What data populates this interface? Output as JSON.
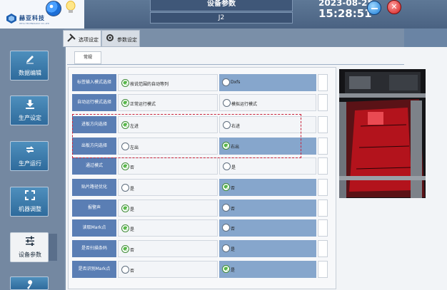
{
  "header": {
    "logo_text": "赫亚科技",
    "logo_sub": "HEYA TECHNOLOGY CO.,LTD",
    "title": "设备参数",
    "subtitle": "J2",
    "date": "2023-08-25",
    "time": "15:28:51"
  },
  "sidebar": {
    "items": [
      {
        "label": "数据编辑",
        "icon": "pencil-icon"
      },
      {
        "label": "生产设定",
        "icon": "download-icon"
      },
      {
        "label": "生产运行",
        "icon": "cycle-icon"
      },
      {
        "label": "机器调整",
        "icon": "frame-icon"
      },
      {
        "label": "设备参数",
        "icon": "sliders-icon",
        "active": true
      },
      {
        "label": "",
        "icon": "wrench-icon"
      }
    ]
  },
  "tabs": [
    {
      "label": "选项设定",
      "icon": "tools-icon",
      "active": true
    },
    {
      "label": "参数设定",
      "icon": "gear-icon"
    }
  ],
  "subtab": {
    "label": "常规"
  },
  "settings": [
    {
      "label": "标签输入模式选择",
      "opt_a": "按说范围的自动等列",
      "opt_b": "Dxfs",
      "selected": "a"
    },
    {
      "label": "自动运行模式选择",
      "opt_a": "正常运行模式",
      "opt_b": "模拟运行模式",
      "selected": "a"
    },
    {
      "label": "进板方向选择",
      "opt_a": "左进",
      "opt_b": "右进",
      "selected": "a"
    },
    {
      "label": "出板方向选择",
      "opt_a": "左出",
      "opt_b": "右出",
      "selected": "b"
    },
    {
      "label": "通过模式",
      "opt_a": "否",
      "opt_b": "是",
      "selected": "a"
    },
    {
      "label": "贴片路径优化",
      "opt_a": "是",
      "opt_b": "否",
      "selected": "b"
    },
    {
      "label": "报警声",
      "opt_a": "是",
      "opt_b": "否",
      "selected": "a"
    },
    {
      "label": "读取Mark点",
      "opt_a": "是",
      "opt_b": "否",
      "selected": "a"
    },
    {
      "label": "是否扫描条码",
      "opt_a": "否",
      "opt_b": "是",
      "selected": "a"
    },
    {
      "label": "是否识别Mark点",
      "opt_a": "否",
      "opt_b": "是",
      "selected": "b"
    }
  ],
  "colors": {
    "header_bg": "#4f6787",
    "label_bg": "#5a7eb4",
    "option_blue": "#86a6cc",
    "highlight_dash": "#c8233b",
    "radio_on": "#58b84a"
  }
}
